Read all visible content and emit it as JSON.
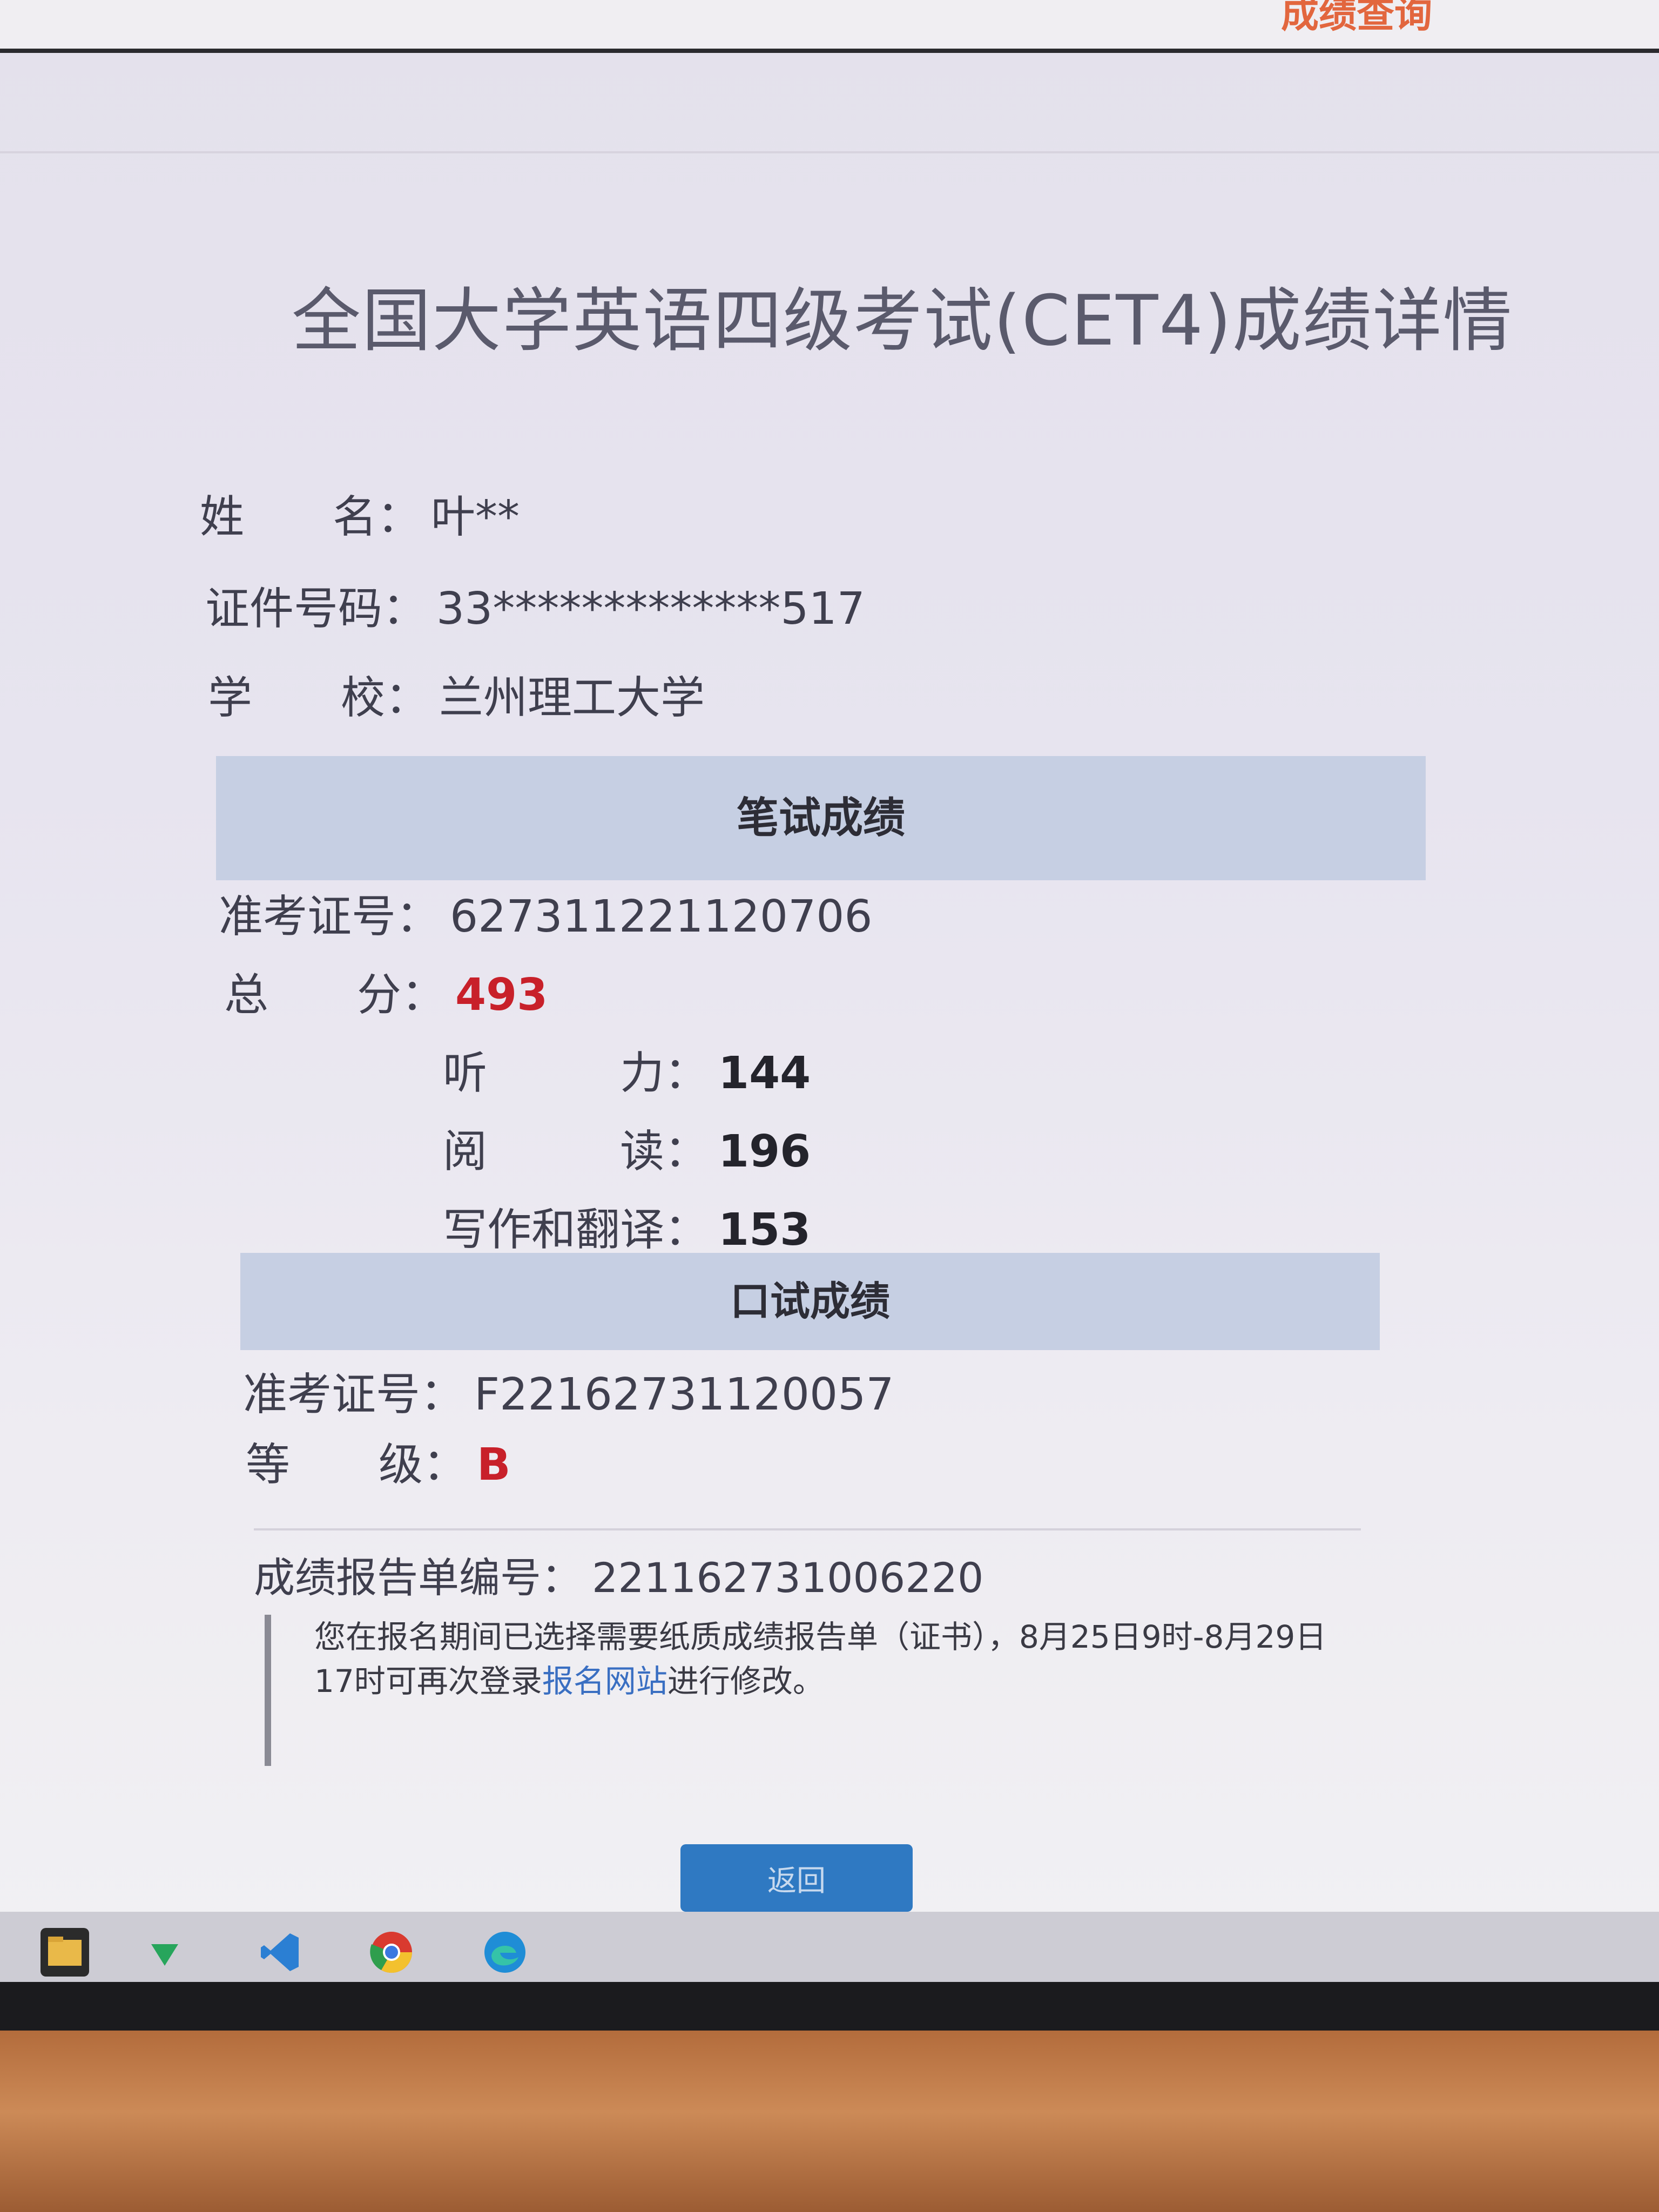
{
  "header": {
    "top_link": "成绩查询"
  },
  "page": {
    "title": "全国大学英语四级考试(CET4)成绩详情"
  },
  "candidate": {
    "name_label": "姓　　名：",
    "name_value": "叶**",
    "id_label": "证件号码：",
    "id_value": "33*************517",
    "school_label": "学　　校：",
    "school_value": "兰州理工大学"
  },
  "written": {
    "section_title": "笔试成绩",
    "ticket_label": "准考证号：",
    "ticket_value": "627311221120706",
    "total_label": "总　　分：",
    "total_value": "493",
    "listening_label": "听　　　力：",
    "listening_value": "144",
    "reading_label": "阅　　　读：",
    "reading_value": "196",
    "writing_label": "写作和翻译：",
    "writing_value": "153"
  },
  "oral": {
    "section_title": "口试成绩",
    "ticket_label": "准考证号：",
    "ticket_value": "F22162731120057",
    "grade_label": "等　　级：",
    "grade_value": "B"
  },
  "report": {
    "number_label": "成绩报告单编号：",
    "number_value": "221162731006220"
  },
  "notice": {
    "text_before": "您在报名期间已选择需要纸质成绩报告单（证书），8月25日9时-8月29日17时可再次登录",
    "link_text": "报名网站",
    "text_after": "进行修改。"
  },
  "actions": {
    "back_label": "返回"
  },
  "taskbar": {
    "icons": [
      "file-explorer-icon",
      "vpn-icon",
      "vscode-icon",
      "chrome-icon",
      "edge-icon"
    ]
  }
}
